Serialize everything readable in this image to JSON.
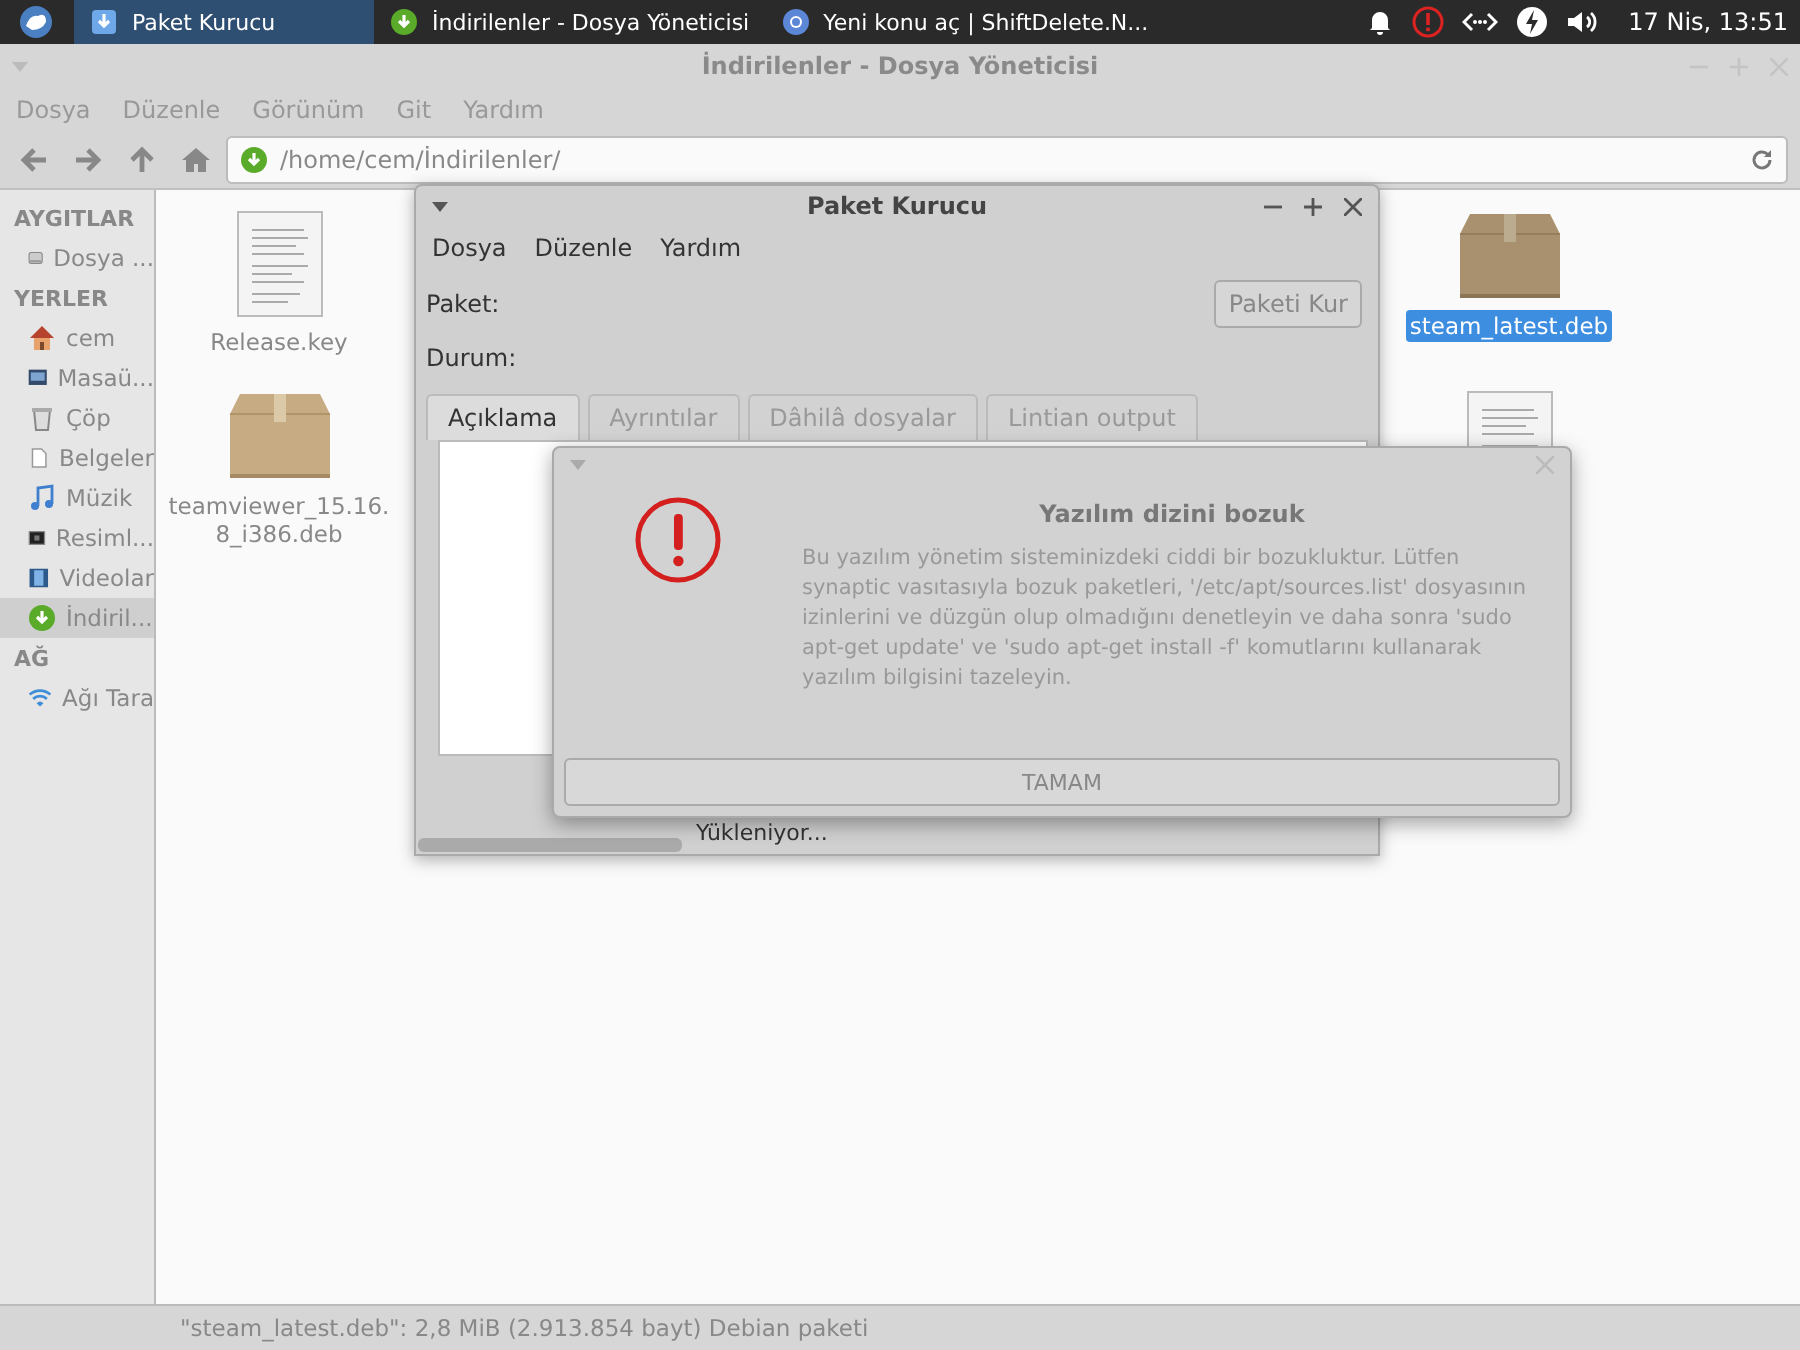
{
  "taskbar": {
    "tasks": [
      {
        "label": "Paket Kurucu",
        "kind": "installer",
        "selected": true
      },
      {
        "label": "İndirilenler - Dosya Yöneticisi",
        "kind": "downloads",
        "selected": false
      },
      {
        "label": "Yeni konu aç | ShiftDelete.N...",
        "kind": "browser",
        "selected": false
      }
    ],
    "clock": "17 Nis, 13:51"
  },
  "window": {
    "title": "İndirilenler - Dosya Yöneticisi",
    "menu": [
      "Dosya",
      "Düzenle",
      "Görünüm",
      "Git",
      "Yardım"
    ],
    "path": "/home/cem/İndirilenler/"
  },
  "sidebar": {
    "sections": [
      {
        "heading": "AYGITLAR",
        "items": [
          {
            "label": "Dosya ...",
            "kind": "drive",
            "selected": false
          }
        ]
      },
      {
        "heading": "YERLER",
        "items": [
          {
            "label": "cem",
            "kind": "home",
            "selected": false
          },
          {
            "label": "Masaü...",
            "kind": "desktop",
            "selected": false
          },
          {
            "label": "Çöp",
            "kind": "trash",
            "selected": false
          },
          {
            "label": "Belgeler",
            "kind": "document",
            "selected": false
          },
          {
            "label": "Müzik",
            "kind": "music",
            "selected": false
          },
          {
            "label": "Resiml...",
            "kind": "pictures",
            "selected": false
          },
          {
            "label": "Videolar",
            "kind": "videos",
            "selected": false
          },
          {
            "label": "İndiril...",
            "kind": "downloads",
            "selected": true
          }
        ]
      },
      {
        "heading": "AĞ",
        "items": [
          {
            "label": "Ağı Tara",
            "kind": "network",
            "selected": false
          }
        ]
      }
    ]
  },
  "files": [
    {
      "name": "Release.key",
      "kind": "text",
      "selected": false
    },
    {
      "name": "teamviewer_15.16.8_i386.deb",
      "kind": "package",
      "selected": false
    },
    {
      "name": "steam_latest.deb",
      "kind": "package",
      "selected": true
    },
    {
      "kind": "text",
      "selected": false
    }
  ],
  "status_bar": "\"steam_latest.deb\": 2,8 MiB (2.913.854 bayt) Debian paketi",
  "installer": {
    "title": "Paket Kurucu",
    "menu": [
      "Dosya",
      "Düzenle",
      "Yardım"
    ],
    "package_label": "Paket:",
    "status_label": "Durum:",
    "install_button": "Paketi Kur",
    "tabs": [
      {
        "label": "Açıklama",
        "selected": true
      },
      {
        "label": "Ayrıntılar",
        "selected": false
      },
      {
        "label": "Dâhilâ dosyalar",
        "selected": false
      },
      {
        "label": "Lintian output",
        "selected": false
      }
    ],
    "progress_text": "Yükleniyor..."
  },
  "dialog": {
    "title": "Yazılım dizini bozuk",
    "message": "Bu yazılım yönetim sisteminizdeki ciddi bir bozukluktur. Lütfen synaptic vasıtasıyla bozuk paketleri, '/etc/apt/sources.list' dosyasının izinlerini ve düzgün olup olmadığını denetleyin ve daha sonra 'sudo apt-get update' ve 'sudo apt-get install -f' komutlarını kullanarak yazılım bilgisini tazeleyin.",
    "button": "TAMAM"
  }
}
